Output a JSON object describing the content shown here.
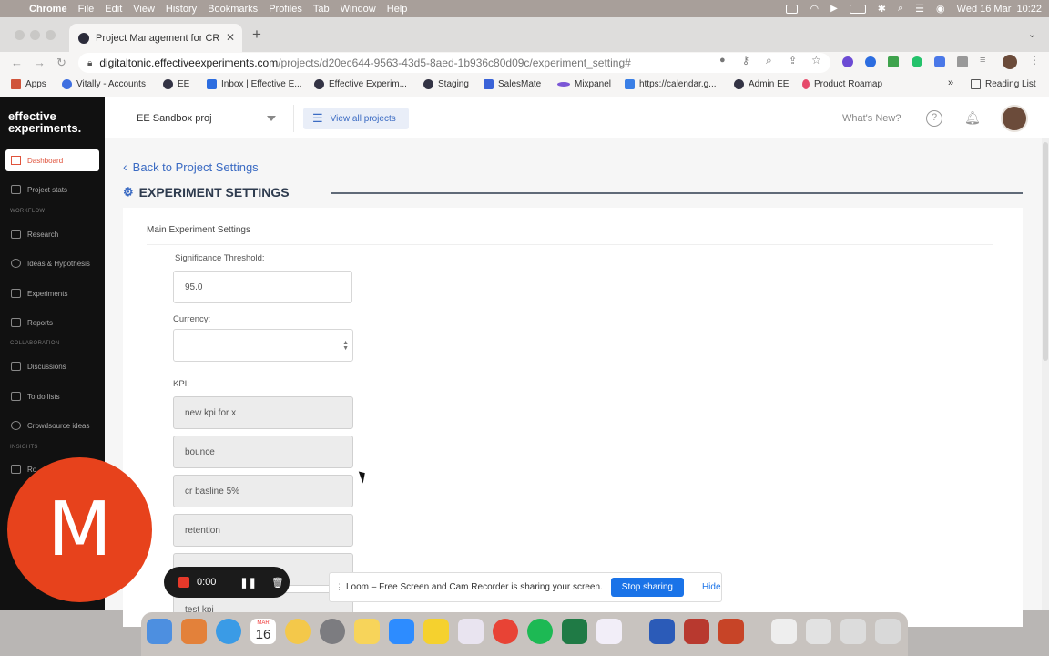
{
  "menubar": {
    "items": [
      "Chrome",
      "File",
      "Edit",
      "View",
      "History",
      "Bookmarks",
      "Profiles",
      "Tab",
      "Window",
      "Help"
    ],
    "clock": "Wed 16 Mar  10:22"
  },
  "browser": {
    "tab_title": "Project Management for CRO",
    "url_host": "digitaltonic.effectiveexperiments.com",
    "url_path": "/projects/d20ec644-9563-43d5-8aed-1b936c80d09c/experiment_setting#",
    "bookmarks": [
      "Apps",
      "Vitally - Accounts",
      "EE",
      "Inbox | Effective E...",
      "Effective Experim...",
      "Staging",
      "SalesMate",
      "Mixpanel",
      "https://calendar.g...",
      "Admin EE",
      "Product Roamap"
    ],
    "reading_list": "Reading List",
    "more": "»"
  },
  "app": {
    "logo_line1": "effective",
    "logo_line2": "experiments.",
    "nav": {
      "dashboard": "Dashboard",
      "project_stats": "Project stats",
      "workflow": "WORKFLOW",
      "research": "Research",
      "ideas": "Ideas & Hypothesis",
      "experiments": "Experiments",
      "reports": "Reports",
      "collaboration": "COLLABORATION",
      "discussions": "Discussions",
      "todo": "To do lists",
      "crowdsource": "Crowdsource ideas",
      "insights": "INSIGHTS",
      "ro": "Ro"
    },
    "project_select": "EE Sandbox proj",
    "view_all": "View all projects",
    "whats_new": "What's New?"
  },
  "page": {
    "back": "Back to Project Settings",
    "title": "EXPERIMENT SETTINGS",
    "card_title": "Main Experiment Settings",
    "significance_label": "Significance Threshold:",
    "significance_value": "95.0",
    "currency_label": "Currency:",
    "currency_value": "",
    "kpi_label": "KPI:",
    "kpis": [
      "new kpi for x",
      "bounce",
      "cr basline 5%",
      "retention"
    ],
    "kpi_partial": "test kpi"
  },
  "overlay": {
    "avatar_letter": "M",
    "timer": "0:00",
    "loom_text": "Loom – Free Screen and Cam Recorder is sharing your screen.",
    "stop": "Stop sharing",
    "hide": "Hide"
  },
  "dock": {
    "calendar_month": "MAR",
    "calendar_day": "16"
  }
}
